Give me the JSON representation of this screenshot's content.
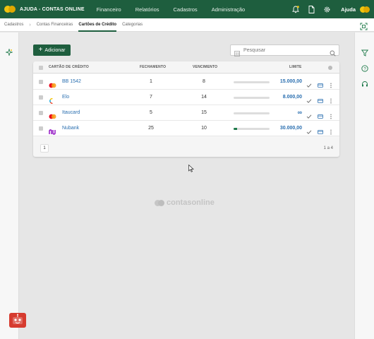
{
  "topbar": {
    "app_title": "AJUDA - CONTAS ONLINE",
    "nav": [
      "Financeiro",
      "Relatórios",
      "Cadastros",
      "Administração"
    ],
    "help_label": "Ajuda"
  },
  "subbar": {
    "breadcrumb": "Cadastros",
    "tabs": [
      "Contas Financeiras",
      "Cartões de Crédito",
      "Categorias"
    ],
    "active_tab": "Cartões de Crédito"
  },
  "toolbar": {
    "add_label": "Adicionar",
    "search_placeholder": "Pesquisar"
  },
  "table": {
    "headers": {
      "card": "CARTÃO DE CRÉDITO",
      "closing": "FECHAMENTO",
      "due": "VENCIMENTO",
      "limit": "LIMITE"
    },
    "rows": [
      {
        "name": "BB 1542",
        "brand": "mastercard",
        "closing": "1",
        "due": "8",
        "usage": 0,
        "limit": "15.000,00"
      },
      {
        "name": "Elo",
        "brand": "elo",
        "closing": "7",
        "due": "14",
        "usage": 0,
        "limit": "8.000,00"
      },
      {
        "name": "Itaucard",
        "brand": "mastercard",
        "closing": "5",
        "due": "15",
        "usage": 0,
        "limit": "∞"
      },
      {
        "name": "Nubank",
        "brand": "nubank",
        "closing": "25",
        "due": "10",
        "usage": 0.1,
        "limit": "30.000,00"
      }
    ],
    "page": "1",
    "count": "1 a 4"
  },
  "watermark": "contasonline",
  "colors": {
    "primary": "#1e5e3e",
    "link": "#2a6fb0",
    "accent": "#f1c40f"
  }
}
